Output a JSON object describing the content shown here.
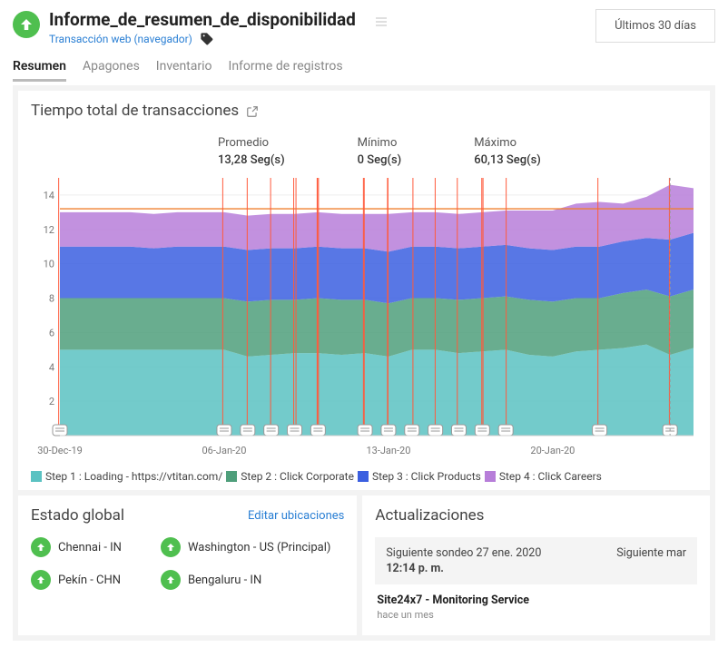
{
  "header": {
    "title": "Informe_de_resumen_de_disponibilidad",
    "subtitle": "Transacción web (navegador)",
    "date_range": "Últimos 30 días"
  },
  "tabs": [
    {
      "label": "Resumen",
      "active": true
    },
    {
      "label": "Apagones",
      "active": false
    },
    {
      "label": "Inventario",
      "active": false
    },
    {
      "label": "Informe de registros",
      "active": false
    }
  ],
  "chart_card": {
    "title": "Tiempo total de transacciones",
    "stats": {
      "avg_label": "Promedio",
      "avg_value": "13,28 Seg(s)",
      "min_label": "Mínimo",
      "min_value": "0 Seg(s)",
      "max_label": "Máximo",
      "max_value": "60,13 Seg(s)"
    }
  },
  "chart_data": {
    "type": "area",
    "xlabel": "",
    "ylabel": "",
    "ylim": [
      0,
      15
    ],
    "yticks": [
      2,
      4,
      6,
      8,
      10,
      12,
      14
    ],
    "categories": [
      "30-Dec-19",
      "31-Dec-19",
      "01-Jan-20",
      "02-Jan-20",
      "03-Jan-20",
      "04-Jan-20",
      "05-Jan-20",
      "06-Jan-20",
      "07-Jan-20",
      "08-Jan-20",
      "09-Jan-20",
      "10-Jan-20",
      "11-Jan-20",
      "12-Jan-20",
      "13-Jan-20",
      "14-Jan-20",
      "15-Jan-20",
      "16-Jan-20",
      "17-Jan-20",
      "18-Jan-20",
      "19-Jan-20",
      "20-Jan-20",
      "21-Jan-20",
      "22-Jan-20",
      "23-Jan-20",
      "24-Jan-20",
      "25-Jan-20",
      "26-Jan-20"
    ],
    "xticks_visible": [
      "30-Dec-19",
      "06-Jan-20",
      "13-Jan-20",
      "20-Jan-20"
    ],
    "series": [
      {
        "name": "Step 1 : Loading - https://vtitan.com/",
        "color": "#5bc2c2",
        "values": [
          5.0,
          5.0,
          5.0,
          5.0,
          5.0,
          5.0,
          5.0,
          5.0,
          4.6,
          4.7,
          4.8,
          4.8,
          4.7,
          4.8,
          4.6,
          5.0,
          5.0,
          4.8,
          4.9,
          5.0,
          4.7,
          4.6,
          4.9,
          5.0,
          5.1,
          5.3,
          4.7,
          5.1
        ]
      },
      {
        "name": "Step 2 : Click Corporate",
        "color": "#4f9f7b",
        "values": [
          3.0,
          3.0,
          3.0,
          3.0,
          3.0,
          3.0,
          3.0,
          3.0,
          3.2,
          3.2,
          3.1,
          3.2,
          3.2,
          3.1,
          3.1,
          3.0,
          3.0,
          3.1,
          3.1,
          3.1,
          3.2,
          3.2,
          3.1,
          3.0,
          3.2,
          3.2,
          3.4,
          3.4
        ]
      },
      {
        "name": "Step 3 : Click Products",
        "color": "#3b5fe0",
        "values": [
          3.0,
          3.0,
          3.0,
          3.0,
          2.9,
          3.0,
          3.0,
          3.0,
          3.0,
          3.0,
          3.0,
          3.0,
          3.0,
          3.0,
          3.0,
          3.0,
          3.0,
          3.0,
          3.0,
          3.0,
          3.0,
          3.0,
          3.0,
          3.0,
          3.0,
          3.0,
          3.3,
          3.3
        ]
      },
      {
        "name": "Step 4 : Click Careers",
        "color": "#b77ed9",
        "values": [
          2.0,
          2.0,
          2.0,
          2.0,
          2.0,
          2.0,
          2.0,
          2.0,
          2.0,
          2.0,
          2.0,
          2.0,
          2.0,
          2.0,
          2.2,
          2.0,
          2.0,
          2.0,
          2.0,
          2.0,
          2.2,
          2.3,
          2.5,
          2.6,
          2.2,
          2.4,
          3.2,
          2.6
        ]
      }
    ],
    "threshold_line": 13.2,
    "event_markers_x_idx": [
      0,
      7,
      8,
      9,
      10,
      10,
      11,
      11,
      11,
      13,
      13,
      14,
      14,
      15,
      16,
      17,
      18,
      18,
      19,
      23,
      26
    ],
    "marker_clusters_idx": [
      0,
      7,
      8,
      9,
      10,
      11,
      13,
      14,
      15,
      16,
      17,
      18,
      19,
      23,
      26
    ]
  },
  "global_status": {
    "title": "Estado global",
    "edit_label": "Editar ubicaciones",
    "locations": [
      {
        "name": "Chennai - IN"
      },
      {
        "name": "Washington - US (Principal)"
      },
      {
        "name": "Pekín - CHN"
      },
      {
        "name": "Bengaluru - IN"
      }
    ]
  },
  "updates": {
    "title": "Actualizaciones",
    "next_poll_label": "Siguiente sondeo",
    "next_poll_date": "27 ene. 2020",
    "next_poll_time": "12:14 p. m.",
    "next_right": "Siguiente mar",
    "entries": [
      {
        "title": "Site24x7 - Monitoring Service",
        "ago": "hace un mes"
      }
    ]
  }
}
